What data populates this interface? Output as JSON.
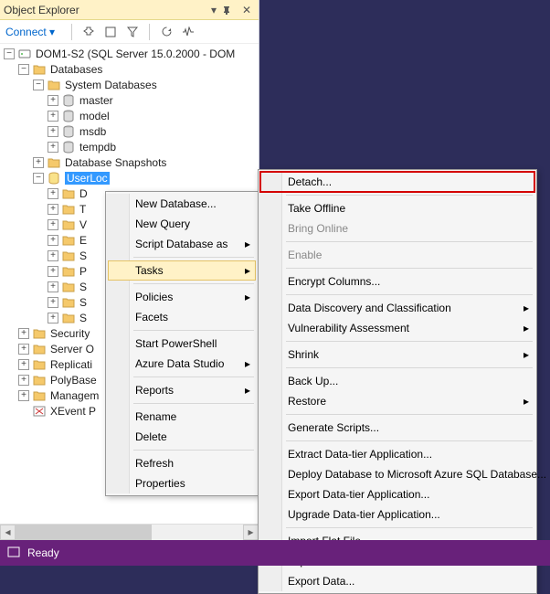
{
  "pane": {
    "title": "Object Explorer"
  },
  "toolbar": {
    "connect": "Connect"
  },
  "tree": {
    "root": "DOM1-S2 (SQL Server 15.0.2000 - DOM",
    "databases": "Databases",
    "sysdb": "System Databases",
    "master": "master",
    "model": "model",
    "msdb": "msdb",
    "tempdb": "tempdb",
    "snapshots": "Database Snapshots",
    "userdb": "UserLoc",
    "sub_d": "D",
    "sub_t": "T",
    "sub_v": "V",
    "sub_e": "E",
    "sub_sy": "S",
    "sub_p": "P",
    "sub_se": "S",
    "sub_st": "S",
    "sub_se2": "S",
    "security": "Security",
    "serverob": "Server O",
    "replication": "Replicati",
    "polybase": "PolyBase",
    "management": "Managem",
    "xevent": "XEvent P"
  },
  "ctx": {
    "newdb": "New Database...",
    "newquery": "New Query",
    "scriptdb": "Script Database as",
    "tasks": "Tasks",
    "policies": "Policies",
    "facets": "Facets",
    "startps": "Start PowerShell",
    "ads": "Azure Data Studio",
    "reports": "Reports",
    "rename": "Rename",
    "delete": "Delete",
    "refresh": "Refresh",
    "properties": "Properties"
  },
  "tasks": {
    "detach": "Detach...",
    "takeoffline": "Take Offline",
    "bringonline": "Bring Online",
    "enable": "Enable",
    "encrypt": "Encrypt Columns...",
    "ddc": "Data Discovery and Classification",
    "va": "Vulnerability Assessment",
    "shrink": "Shrink",
    "backup": "Back Up...",
    "restore": "Restore",
    "genscripts": "Generate Scripts...",
    "extractdt": "Extract Data-tier Application...",
    "deployazure": "Deploy Database to Microsoft Azure SQL Database...",
    "exportdt": "Export Data-tier Application...",
    "upgradedt": "Upgrade Data-tier Application...",
    "importff": "Import Flat File...",
    "importd": "Import Data...",
    "exportd": "Export Data..."
  },
  "status": {
    "ready": "Ready"
  }
}
